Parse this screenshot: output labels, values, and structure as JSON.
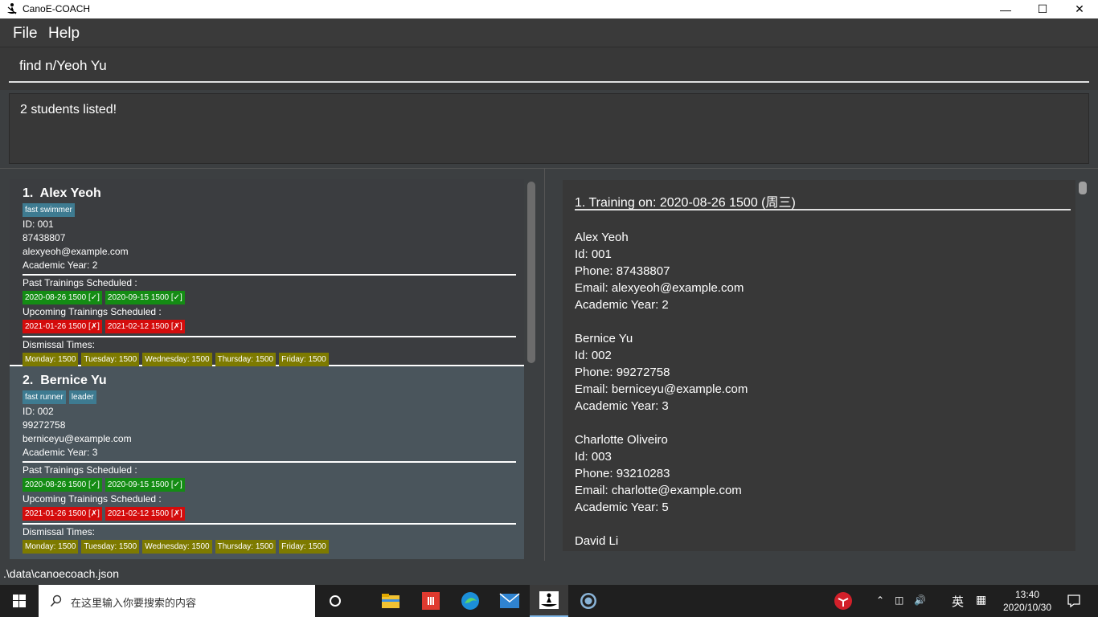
{
  "window": {
    "title": "CanoE-COACH"
  },
  "menu": {
    "file": "File",
    "help": "Help"
  },
  "command": {
    "value": "find n/Yeoh Yu"
  },
  "result": {
    "message": "2 students listed!"
  },
  "students": [
    {
      "index": "1.",
      "name": "Alex Yeoh",
      "tags": [
        "fast swimmer"
      ],
      "id": "ID: 001",
      "phone": "87438807",
      "email": "alexyeoh@example.com",
      "year": "Academic Year: 2",
      "past_label": "Past Trainings Scheduled :",
      "past": [
        "2020-08-26 1500 [✓]",
        "2020-09-15 1500 [✓]"
      ],
      "upcoming_label": "Upcoming Trainings Scheduled :",
      "upcoming": [
        "2021-01-26 1500 [✗]",
        "2021-02-12 1500 [✗]"
      ],
      "dismissal_label": "Dismissal Times:",
      "dismissal": [
        "Monday: 1500",
        "Tuesday: 1500",
        "Wednesday: 1500",
        "Thursday: 1500",
        "Friday: 1500"
      ]
    },
    {
      "index": "2.",
      "name": "Bernice Yu",
      "tags": [
        "fast runner",
        "leader"
      ],
      "id": "ID: 002",
      "phone": "99272758",
      "email": "berniceyu@example.com",
      "year": "Academic Year: 3",
      "past_label": "Past Trainings Scheduled :",
      "past": [
        "2020-08-26 1500 [✓]",
        "2020-09-15 1500 [✓]"
      ],
      "upcoming_label": "Upcoming Trainings Scheduled :",
      "upcoming": [
        "2021-01-26 1500 [✗]",
        "2021-02-12 1500 [✗]"
      ],
      "dismissal_label": "Dismissal Times:",
      "dismissal": [
        "Monday: 1500",
        "Tuesday: 1500",
        "Wednesday: 1500",
        "Thursday: 1500",
        "Friday: 1500"
      ]
    }
  ],
  "training": {
    "heading": "1.  Training on: 2020-08-26 1500 (周三)",
    "students": [
      {
        "name": "Alex Yeoh",
        "id": "Id: 001",
        "phone": "Phone: 87438807",
        "email": "Email: alexyeoh@example.com",
        "year": "Academic  Year: 2"
      },
      {
        "name": "Bernice Yu",
        "id": "Id: 002",
        "phone": "Phone: 99272758",
        "email": "Email: berniceyu@example.com",
        "year": "Academic  Year: 3"
      },
      {
        "name": "Charlotte Oliveiro",
        "id": "Id: 003",
        "phone": "Phone: 93210283",
        "email": "Email: charlotte@example.com",
        "year": "Academic  Year: 5"
      },
      {
        "name": "David Li"
      }
    ]
  },
  "status": {
    "path": ".\\data\\canoecoach.json"
  },
  "taskbar": {
    "search_placeholder": "在这里输入你要搜索的内容",
    "ime": "英",
    "time": "13:40",
    "date": "2020/10/30"
  },
  "colors": {
    "accent_tag": "#3e7b91",
    "past": "#148c14",
    "upcoming": "#d40c0c",
    "dismissal": "#7d7a00"
  }
}
